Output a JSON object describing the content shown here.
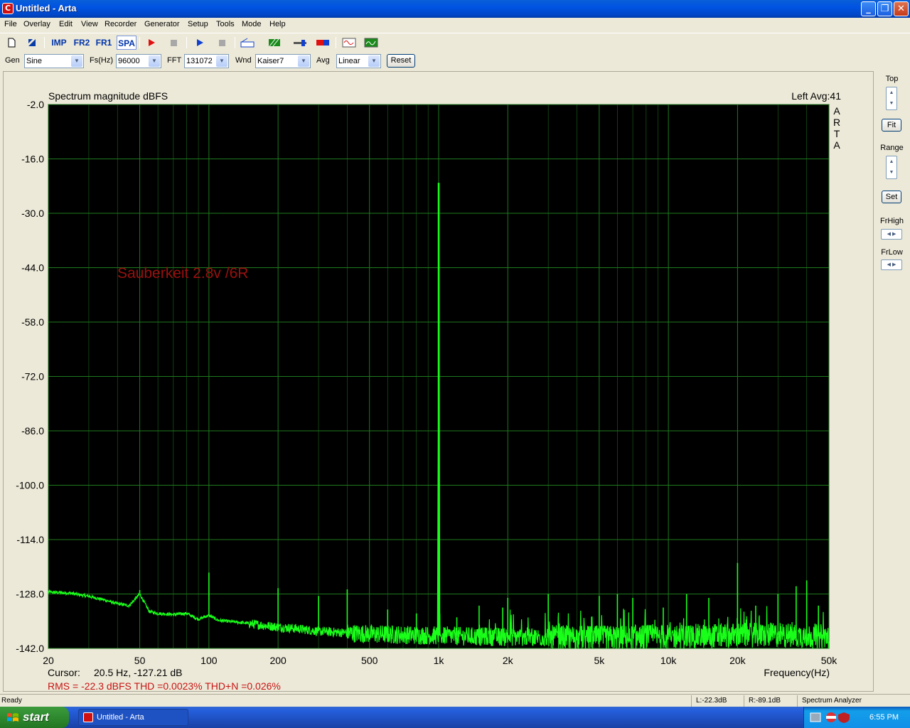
{
  "window": {
    "title": "Untitled - Arta",
    "minimize": "_",
    "maximize": "❐",
    "close": "✕"
  },
  "menu": [
    "File",
    "Overlay",
    "Edit",
    "View",
    "Recorder",
    "Generator",
    "Setup",
    "Tools",
    "Mode",
    "Help"
  ],
  "toolbar": {
    "imp": "IMP",
    "fr2": "FR2",
    "fr1": "FR1",
    "spa": "SPA"
  },
  "controls": {
    "gen_label": "Gen",
    "gen_value": "Sine",
    "fs_label": "Fs(Hz)",
    "fs_value": "96000",
    "fft_label": "FFT",
    "fft_value": "131072",
    "wnd_label": "Wnd",
    "wnd_value": "Kaiser7",
    "avg_label": "Avg",
    "avg_value": "Linear",
    "reset": "Reset"
  },
  "right_panel": {
    "top": "Top",
    "fit": "Fit",
    "range": "Range",
    "set": "Set",
    "frhigh": "FrHigh",
    "frlow": "FrLow"
  },
  "plot_text": {
    "title": "Spectrum magnitude dBFS",
    "channel": "Left  Avg:41",
    "arta": [
      "A",
      "R",
      "T",
      "A"
    ],
    "annotation": "Sauberkeit 2.8v /6R",
    "cursor_label": "Cursor:",
    "cursor_value": "20.5 Hz, -127.21 dB",
    "xlabel": "Frequency(Hz)",
    "measure": "RMS =  -22.3 dBFS   THD =0.0023%   THD+N =0.026%"
  },
  "status": {
    "ready": "Ready",
    "left": "L:-22.3dB",
    "right": "R:-89.1dB",
    "mode": "Spectrum Analyzer"
  },
  "taskbar": {
    "start": "start",
    "task": "Untitled - Arta",
    "clock": "6:55 PM"
  },
  "colors": {
    "trace": "#1aff1a",
    "grid": "#1e7a1e",
    "plot_bg": "#000000",
    "annotation": "#9b1010",
    "measure": "#c81414"
  },
  "chart_data": {
    "type": "line",
    "title": "Spectrum magnitude dBFS",
    "xlabel": "Frequency(Hz)",
    "ylabel": "",
    "x_scale": "log",
    "xlim": [
      20,
      50000
    ],
    "ylim": [
      -142,
      -2
    ],
    "x_ticks": [
      20,
      50,
      100,
      200,
      500,
      1000,
      2000,
      5000,
      10000,
      20000,
      50000
    ],
    "x_tick_labels": [
      "20",
      "50",
      "100",
      "200",
      "500",
      "1k",
      "2k",
      "5k",
      "10k",
      "20k",
      "50k"
    ],
    "y_ticks": [
      -2.0,
      -16.0,
      -30.0,
      -44.0,
      -58.0,
      -72.0,
      -86.0,
      -100.0,
      -114.0,
      -128.0,
      -142.0
    ],
    "y_tick_labels": [
      "-2.0",
      "-16.0",
      "-30.0",
      "-44.0",
      "-58.0",
      "-72.0",
      "-86.0",
      "-100.0",
      "-114.0",
      "-128.0",
      "-142.0"
    ],
    "grid": true,
    "series": [
      {
        "color": "#1aff1a",
        "noise_floor": [
          [
            20,
            -127.5
          ],
          [
            25,
            -127.8
          ],
          [
            30,
            -128.6
          ],
          [
            35,
            -129.5
          ],
          [
            40,
            -130.5
          ],
          [
            45,
            -131.0
          ],
          [
            50,
            -128.0
          ],
          [
            55,
            -132.5
          ],
          [
            60,
            -133.0
          ],
          [
            70,
            -133.3
          ],
          [
            80,
            -133.0
          ],
          [
            90,
            -134.5
          ],
          [
            100,
            -133.5
          ],
          [
            110,
            -134.8
          ],
          [
            130,
            -135.2
          ],
          [
            150,
            -135.6
          ],
          [
            180,
            -136.2
          ],
          [
            200,
            -136.5
          ],
          [
            250,
            -137.0
          ],
          [
            300,
            -137.6
          ],
          [
            400,
            -138.0
          ],
          [
            500,
            -138.3
          ],
          [
            700,
            -138.5
          ],
          [
            1000,
            -138.7
          ],
          [
            1500,
            -139.0
          ],
          [
            2000,
            -139.0
          ],
          [
            3000,
            -139.2
          ],
          [
            5000,
            -139.3
          ],
          [
            7000,
            -139.2
          ],
          [
            10000,
            -139.0
          ],
          [
            15000,
            -138.8
          ],
          [
            20000,
            -138.6
          ],
          [
            30000,
            -138.6
          ],
          [
            40000,
            -138.8
          ],
          [
            50000,
            -139.0
          ]
        ],
        "peaks": [
          [
            50,
            -127.0
          ],
          [
            100,
            -122.5
          ],
          [
            200,
            -126.5
          ],
          [
            300,
            -128.5
          ],
          [
            400,
            -126.8
          ],
          [
            600,
            -132.0
          ],
          [
            800,
            -133.0
          ],
          [
            1000,
            -22.3
          ],
          [
            1200,
            -134.0
          ],
          [
            1500,
            -131.0
          ],
          [
            1900,
            -131.5
          ],
          [
            2000,
            -129.0
          ],
          [
            3000,
            -128.0
          ],
          [
            5000,
            -128.5
          ],
          [
            6000,
            -128.0
          ],
          [
            7000,
            -129.0
          ],
          [
            9500,
            -131.5
          ],
          [
            12000,
            -128.0
          ],
          [
            15000,
            -129.0
          ],
          [
            20000,
            -120.0
          ],
          [
            24000,
            -131.0
          ],
          [
            30000,
            -128.0
          ],
          [
            36000,
            -126.0
          ],
          [
            40000,
            -124.5
          ],
          [
            45000,
            -131.0
          ]
        ]
      }
    ]
  }
}
